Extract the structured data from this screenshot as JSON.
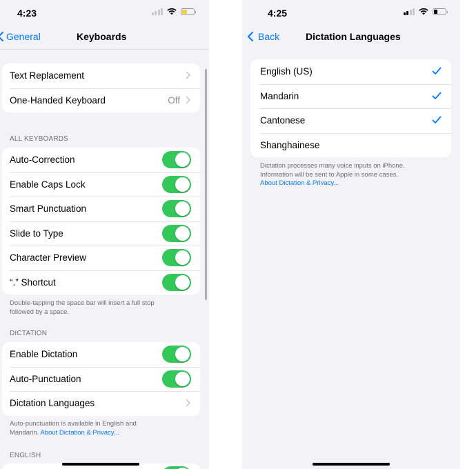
{
  "left": {
    "status": {
      "time": "4:23"
    },
    "nav": {
      "back_label": "General",
      "title": "Keyboards"
    },
    "group1": [
      {
        "label": "Text Replacement",
        "detail": ""
      },
      {
        "label": "One-Handed Keyboard",
        "detail": "Off"
      }
    ],
    "all_keyboards": {
      "header": "ALL KEYBOARDS",
      "rows": [
        {
          "label": "Auto-Correction",
          "on": true
        },
        {
          "label": "Enable Caps Lock",
          "on": true
        },
        {
          "label": "Smart Punctuation",
          "on": true
        },
        {
          "label": "Slide to Type",
          "on": true
        },
        {
          "label": "Character Preview",
          "on": true
        },
        {
          "label": "“.” Shortcut",
          "on": true
        }
      ],
      "footer_line1": "Double-tapping the space bar will insert a full stop",
      "footer_line2": "followed by a space."
    },
    "dictation": {
      "header": "DICTATION",
      "rows": [
        {
          "label": "Enable Dictation",
          "on": true
        },
        {
          "label": "Auto-Punctuation",
          "on": true
        }
      ],
      "languages_label": "Dictation Languages",
      "footer_line1": "Auto-punctuation is available in English and",
      "footer_line2_prefix": "Mandarin.",
      "footer_link": "About Dictation & Privacy..."
    },
    "english": {
      "header": "ENGLISH"
    }
  },
  "right": {
    "status": {
      "time": "4:25"
    },
    "nav": {
      "back_label": "Back",
      "title": "Dictation Languages"
    },
    "languages": [
      {
        "label": "English (US)",
        "checked": true
      },
      {
        "label": "Mandarin",
        "checked": true
      },
      {
        "label": "Cantonese",
        "checked": true
      },
      {
        "label": "Shanghainese",
        "checked": false
      }
    ],
    "footer_line1": "Dictation processes many voice inputs on iPhone.",
    "footer_line2": "Information will be sent to Apple in some cases.",
    "footer_link": "About Dictation & Privacy..."
  },
  "colors": {
    "accent": "#007aff",
    "toggle_on": "#34c759",
    "background": "#f2f2f7",
    "battery_left": "#f4d03f",
    "battery_right": "#000000"
  }
}
